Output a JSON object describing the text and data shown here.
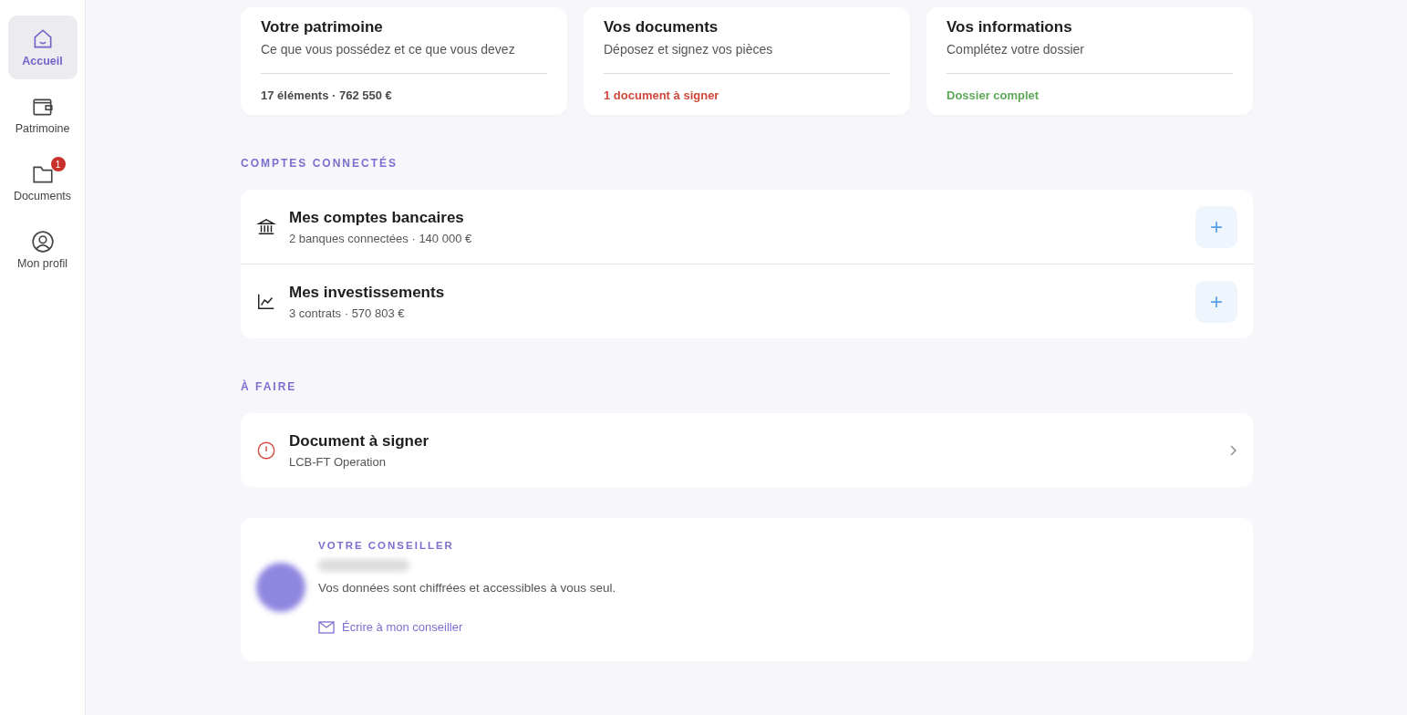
{
  "sidebar": {
    "items": [
      {
        "label": "Accueil",
        "kind": "home",
        "selected": true
      },
      {
        "label": "Patrimoine",
        "kind": "wallet",
        "selected": false
      },
      {
        "label": "Documents",
        "kind": "folder",
        "selected": false,
        "badge": "1"
      },
      {
        "label": "Mon profil",
        "kind": "user",
        "selected": false
      }
    ]
  },
  "summary_cards": [
    {
      "title": "Votre patrimoine",
      "subtitle": "Ce que vous possédez et ce que vous devez",
      "status": "17 éléments · 762 550 €",
      "color": "#4a4a4a"
    },
    {
      "title": "Vos documents",
      "subtitle": "Déposez et signez vos pièces",
      "status": "1 document à signer",
      "color": "#d0473b"
    },
    {
      "title": "Vos informations",
      "subtitle": "Complétez votre dossier",
      "status": "Dossier complet",
      "color": "#5fa85a"
    }
  ],
  "connected_accounts": {
    "heading": "COMPTES CONNECTÉS",
    "rows": [
      {
        "kind": "bank",
        "title": "Mes comptes bancaires",
        "detail": "2 banques connectées · 140 000 €",
        "action": "+"
      },
      {
        "kind": "chart",
        "title": "Mes investissements",
        "detail": "3 contrats · 570 803 €",
        "action": "+"
      }
    ]
  },
  "todo": {
    "heading": "À FAIRE",
    "items": [
      {
        "kind": "alert",
        "title": "Document à signer",
        "detail": "LCB-FT Operation"
      }
    ]
  },
  "advisor": {
    "heading": "VOTRE CONSEILLER",
    "note": "Vos données sont chiffrées et accessibles à vous seul.",
    "contact_link": "Écrire à mon conseiller"
  }
}
